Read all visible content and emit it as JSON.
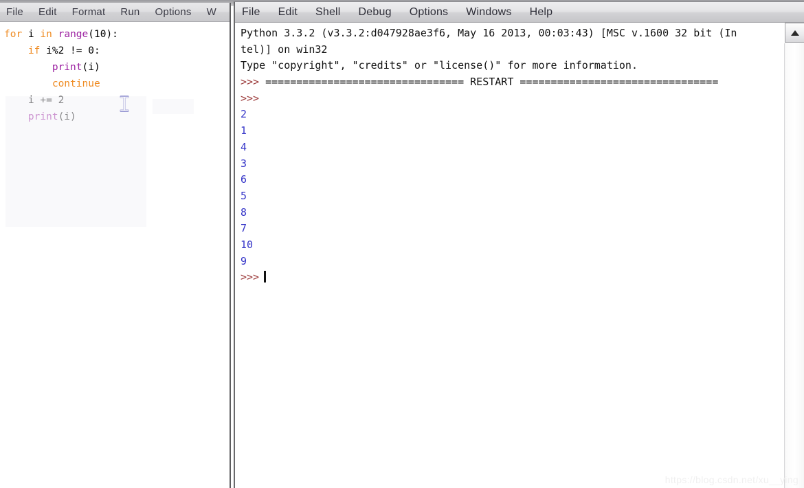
{
  "editor_window": {
    "menu": [
      {
        "label": "File"
      },
      {
        "label": "Edit"
      },
      {
        "label": "Format"
      },
      {
        "label": "Run"
      },
      {
        "label": "Options"
      },
      {
        "label": "W"
      }
    ],
    "code_lines": [
      [
        {
          "t": "for",
          "c": "kw"
        },
        {
          "t": " i ",
          "c": "def"
        },
        {
          "t": "in",
          "c": "kw"
        },
        {
          "t": " ",
          "c": "def"
        },
        {
          "t": "range",
          "c": "bi"
        },
        {
          "t": "(10):",
          "c": "def"
        }
      ],
      [
        {
          "t": "    ",
          "c": "def"
        },
        {
          "t": "if",
          "c": "kw"
        },
        {
          "t": " i%2 != 0:",
          "c": "def"
        }
      ],
      [
        {
          "t": "        ",
          "c": "def"
        },
        {
          "t": "print",
          "c": "bi"
        },
        {
          "t": "(i)",
          "c": "def"
        }
      ],
      [
        {
          "t": "        ",
          "c": "def"
        },
        {
          "t": "continue",
          "c": "kw"
        }
      ],
      [
        {
          "t": "    i += 2",
          "c": "def"
        }
      ],
      [
        {
          "t": "    ",
          "c": "def"
        },
        {
          "t": "print",
          "c": "bi"
        },
        {
          "t": "(i)",
          "c": "def"
        }
      ]
    ],
    "cursor_icon": "text-ibeam-cursor"
  },
  "shell_window": {
    "menu": [
      {
        "label": "File"
      },
      {
        "label": "Edit"
      },
      {
        "label": "Shell"
      },
      {
        "label": "Debug"
      },
      {
        "label": "Options"
      },
      {
        "label": "Windows"
      },
      {
        "label": "Help"
      }
    ],
    "lines": [
      {
        "kind": "plain",
        "text": "Python 3.3.2 (v3.3.2:d047928ae3f6, May 16 2013, 00:03:43) [MSC v.1600 32 bit (In"
      },
      {
        "kind": "plain",
        "text": "tel)] on win32"
      },
      {
        "kind": "plain",
        "text": "Type \"copyright\", \"credits\" or \"license()\" for more information."
      },
      {
        "kind": "restart",
        "prompt": ">>> ",
        "text": "================================ RESTART ================================"
      },
      {
        "kind": "prompt",
        "prompt": ">>>"
      },
      {
        "kind": "output",
        "text": "2"
      },
      {
        "kind": "output",
        "text": "1"
      },
      {
        "kind": "output",
        "text": "4"
      },
      {
        "kind": "output",
        "text": "3"
      },
      {
        "kind": "output",
        "text": "6"
      },
      {
        "kind": "output",
        "text": "5"
      },
      {
        "kind": "output",
        "text": "8"
      },
      {
        "kind": "output",
        "text": "7"
      },
      {
        "kind": "output",
        "text": "10"
      },
      {
        "kind": "output",
        "text": "9"
      },
      {
        "kind": "caret",
        "prompt": ">>>"
      }
    ],
    "scrollbar": {
      "up_arrow_icon": "scroll-up-arrow-icon"
    }
  },
  "watermark": {
    "text": "https://blog.csdn.net/xu__ying"
  },
  "colors": {
    "keyword": "#ef8b22",
    "builtin": "#9b1fa0",
    "output": "#3434c8",
    "prompt": "#9c3b3b",
    "text": "#000000",
    "menubar_bg": "#dfdfe1",
    "window_bg": "#ffffff"
  }
}
